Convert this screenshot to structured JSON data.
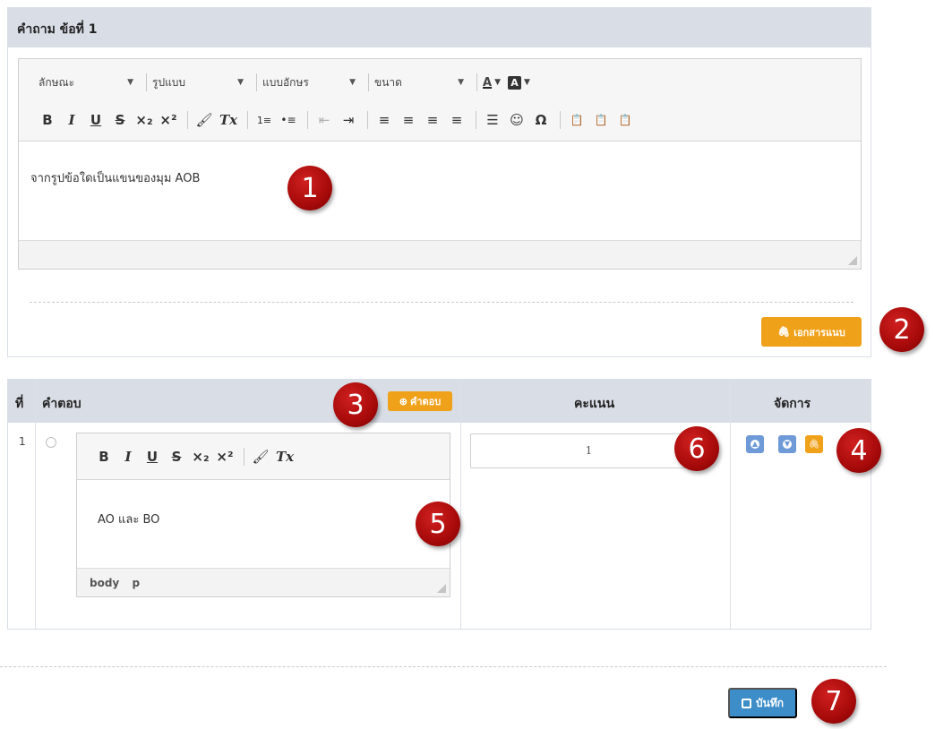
{
  "question_panel": {
    "title": "คำถาม ข้อที่ 1",
    "toolbar": {
      "combos": [
        "ลักษณะ",
        "รูปแบบ",
        "แบบอักษร",
        "ขนาด"
      ],
      "text_color_label": "A",
      "bg_color_label": "A",
      "format_buttons": [
        "B",
        "I",
        "U",
        "S",
        "×₂",
        "×²",
        "🖌",
        "Tx",
        "1≡",
        "•≡",
        "⇤",
        "⇥",
        "≡",
        "≡",
        "≡",
        "≡",
        "☰",
        "☺",
        "Ω",
        "📋",
        "📋",
        "📋"
      ]
    },
    "content": "จากรูปข้อใดเป็นแขนของมุม AOB",
    "attach_button": "เอกสารแนบ"
  },
  "answers_table": {
    "headers": {
      "number": "ที่",
      "answer": "คำตอบ",
      "score": "คะแนน",
      "manage": "จัดการ"
    },
    "add_answer_button": "คำตอบ",
    "rows": [
      {
        "number": "1",
        "content": "AO และ BO",
        "path": [
          "body",
          "p"
        ],
        "score": "1"
      }
    ],
    "answer_toolbar": [
      "B",
      "I",
      "U",
      "S",
      "×₂",
      "×²",
      "🖌",
      "Tx"
    ]
  },
  "save_button": "บันทึก",
  "markers": [
    "1",
    "2",
    "3",
    "4",
    "5",
    "6",
    "7"
  ],
  "colors": {
    "header_bg": "#d8dde6",
    "accent_orange": "#f0a11a",
    "accent_blue": "#3d8ec8",
    "marker_red": "#b00c0c"
  }
}
